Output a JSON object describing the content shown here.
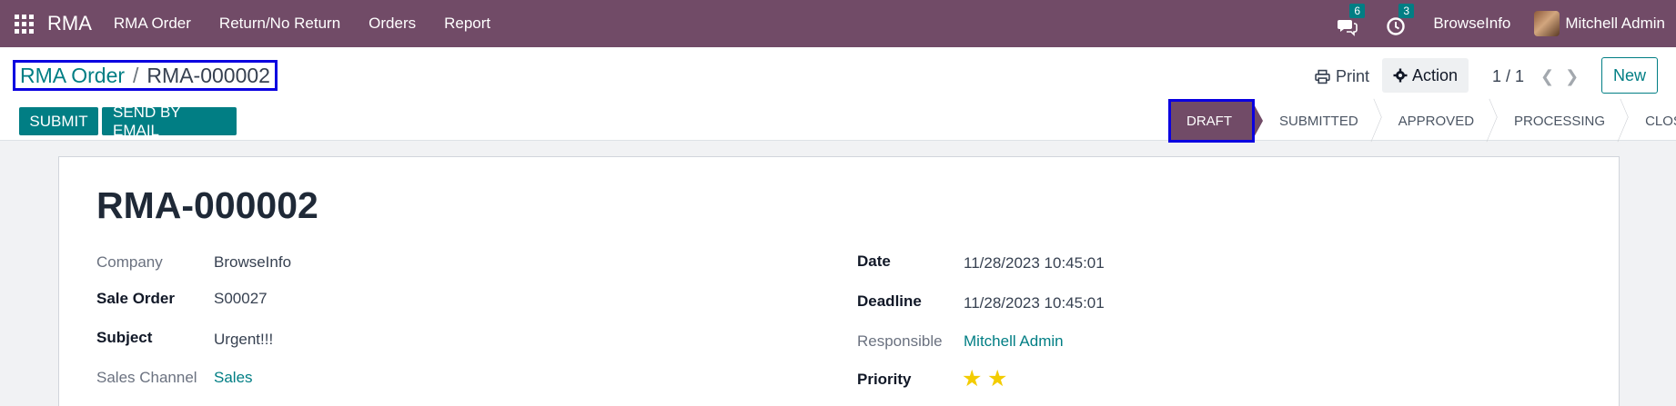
{
  "navbar": {
    "app_name": "RMA",
    "menu": [
      "RMA Order",
      "Return/No Return",
      "Orders",
      "Report"
    ],
    "messages_count": "6",
    "activities_count": "3",
    "company": "BrowseInfo",
    "user": "Mitchell Admin",
    "bg_color": "#714b67"
  },
  "control": {
    "breadcrumb_parent": "RMA Order",
    "breadcrumb_sep": "/",
    "breadcrumb_current": "RMA-000002",
    "submit_label": "SUBMIT",
    "send_email_label": "SEND BY EMAIL",
    "print_label": "Print",
    "action_label": "Action",
    "pager": "1 / 1",
    "new_label": "New",
    "accent_color": "#017e84"
  },
  "status": {
    "stages": [
      "DRAFT",
      "SUBMITTED",
      "APPROVED",
      "PROCESSING",
      "CLOSED"
    ],
    "current": "DRAFT"
  },
  "record": {
    "title": "RMA-000002",
    "company_label": "Company",
    "company_value": "BrowseInfo",
    "sale_order_label": "Sale Order",
    "sale_order_value": "S00027",
    "subject_label": "Subject",
    "subject_value": "Urgent!!!",
    "sales_channel_label": "Sales Channel",
    "sales_channel_value": "Sales",
    "date_label": "Date",
    "date_value": "11/28/2023 10:45:01",
    "deadline_label": "Deadline",
    "deadline_value": "11/28/2023 10:45:01",
    "responsible_label": "Responsible",
    "responsible_value": "Mitchell Admin",
    "priority_label": "Priority",
    "priority_stars": 2
  }
}
